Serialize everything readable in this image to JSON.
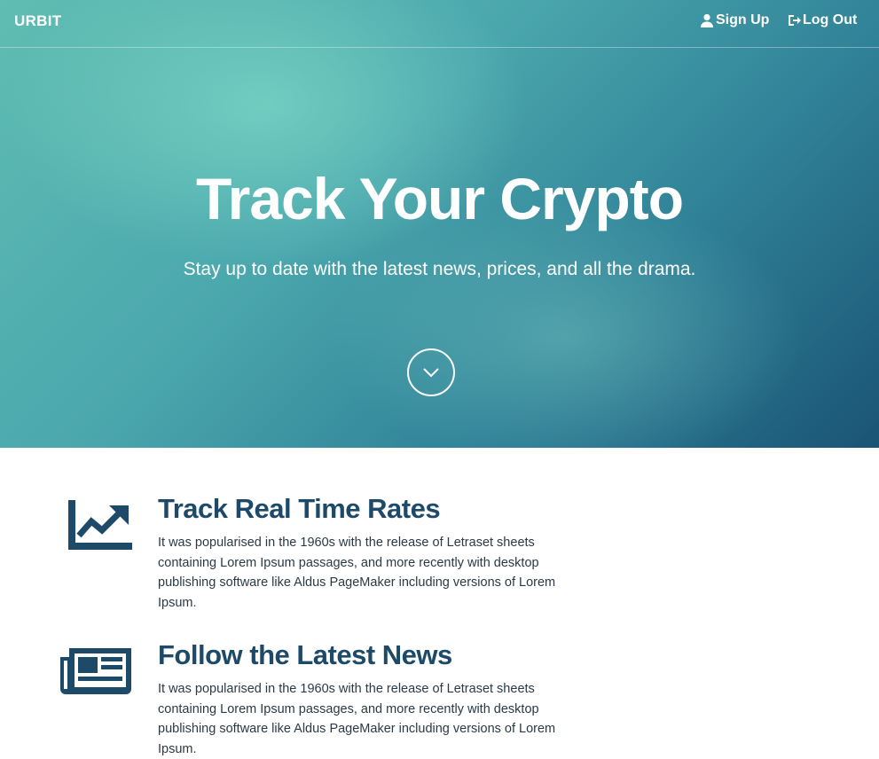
{
  "navbar": {
    "brand": "URBIT",
    "signup_label": "Sign Up",
    "logout_label": "Log Out",
    "signup_icon": "user-icon",
    "logout_icon": "sign-out-icon"
  },
  "hero": {
    "title": "Track Your Crypto",
    "subtitle": "Stay up to date with the latest news, prices, and all the drama.",
    "scroll_icon": "chevron-down-circle-icon"
  },
  "features": [
    {
      "icon": "line-chart-icon",
      "title": "Track Real Time Rates",
      "text": "It was popularised in the 1960s with the release of Letraset sheets containing Lorem Ipsum passages, and more recently with desktop publishing software like Aldus PageMaker including versions of Lorem Ipsum."
    },
    {
      "icon": "newspaper-icon",
      "title": "Follow the Latest News",
      "text": "It was popularised in the 1960s with the release of Letraset sheets containing Lorem Ipsum passages, and more recently with desktop publishing software like Aldus PageMaker including versions of Lorem Ipsum."
    }
  ],
  "colors": {
    "hero_light": "#5fbdb3",
    "hero_dark": "#1a5476",
    "heading": "#1d4a68",
    "text": "#2a3a46"
  }
}
